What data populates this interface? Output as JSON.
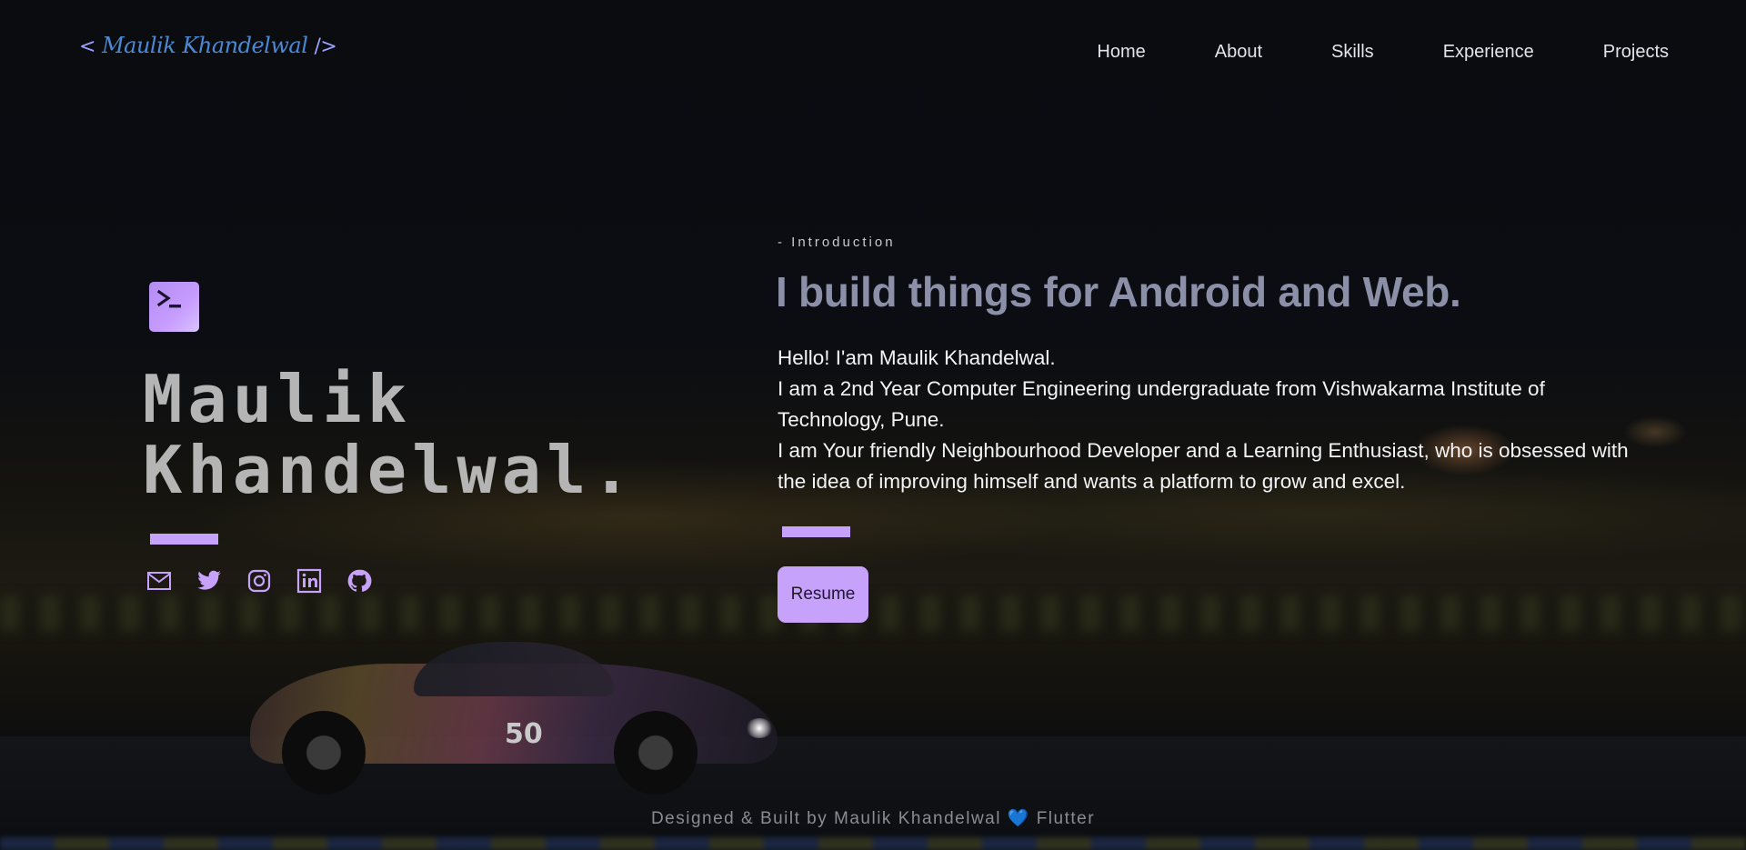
{
  "header": {
    "logo_open": "<",
    "logo_name": "Maulik Khandelwal",
    "logo_close": "/>",
    "nav": [
      {
        "label": "Home"
      },
      {
        "label": "About"
      },
      {
        "label": "Skills"
      },
      {
        "label": "Experience"
      },
      {
        "label": "Projects"
      }
    ]
  },
  "hero": {
    "icon": "terminal-icon",
    "name_line1": "Maulik",
    "name_line2": "Khandelwal.",
    "socials": [
      {
        "icon": "mail-icon"
      },
      {
        "icon": "twitter-icon"
      },
      {
        "icon": "instagram-icon"
      },
      {
        "icon": "linkedin-icon"
      },
      {
        "icon": "github-icon"
      }
    ]
  },
  "intro": {
    "label": "- Introduction",
    "headline": "I build things for Android and Web.",
    "bio": [
      "Hello! I'am Maulik Khandelwal.",
      "I am a 2nd Year Computer Engineering undergraduate from Vishwakarma Institute of Technology, Pune.",
      "I am Your friendly Neighbourhood Developer and a Learning Enthusiast, who is obsessed with the idea of improving himself and wants a platform to grow and excel."
    ],
    "resume_label": "Resume"
  },
  "background": {
    "car_number": "50"
  },
  "footer": {
    "text_before": "Designed & Built by Maulik Khandelwal",
    "heart": "💙",
    "text_after": "Flutter"
  },
  "colors": {
    "accent": "#c6a2fb",
    "logo": "#4a89d4",
    "headline": "#8b90a8",
    "name": "#b5b5b5"
  }
}
